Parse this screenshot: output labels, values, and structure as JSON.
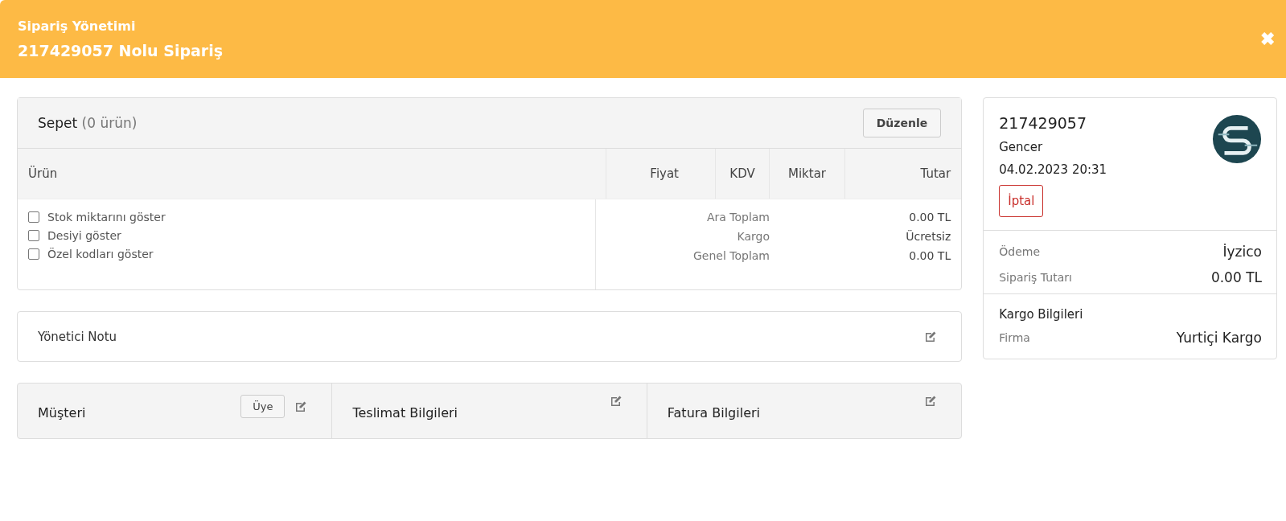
{
  "header": {
    "subtitle": "Sipariş Yönetimi",
    "title": "217429057 Nolu Sipariş",
    "close": "✖"
  },
  "cart": {
    "title": "Sepet",
    "count": "(0 ürün)",
    "edit_button": "Düzenle",
    "columns": [
      "Ürün",
      "Fiyat",
      "KDV",
      "Miktar",
      "Tutar"
    ],
    "options": [
      {
        "label": "Stok miktarını göster",
        "checked": false
      },
      {
        "label": "Desiyi göster",
        "checked": false
      },
      {
        "label": "Özel kodları göster",
        "checked": false
      }
    ],
    "totals": [
      {
        "label": "Ara Toplam",
        "value": "0.00 TL"
      },
      {
        "label": "Kargo",
        "value": "Ücretsiz"
      },
      {
        "label": "Genel Toplam",
        "value": "0.00 TL"
      }
    ]
  },
  "admin_note": {
    "title": "Yönetici Notu"
  },
  "info_cards": [
    {
      "title": "Müşteri",
      "badge": "Üye"
    },
    {
      "title": "Teslimat Bilgileri"
    },
    {
      "title": "Fatura Bilgileri"
    }
  ],
  "summary": {
    "order_no": "217429057",
    "customer": "Gencer",
    "date": "04.02.2023 20:31",
    "status": "İptal",
    "payment": [
      {
        "label": "Ödeme",
        "value": "İyzico"
      },
      {
        "label": "Sipariş Tutarı",
        "value": "0.00 TL"
      }
    ],
    "shipping": {
      "title": "Kargo Bilgileri",
      "rows": [
        {
          "label": "Firma",
          "value": "Yurtiçi Kargo"
        }
      ]
    }
  }
}
